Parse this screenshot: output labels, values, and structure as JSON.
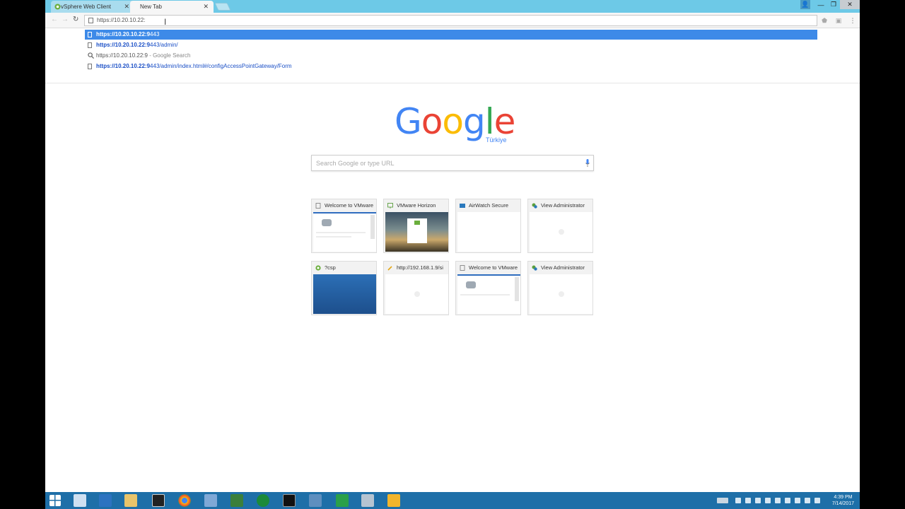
{
  "browser": {
    "tabs": [
      {
        "label": "vSphere Web Client",
        "active": false
      },
      {
        "label": "New Tab",
        "active": true
      }
    ],
    "address_value": "https://10.20.10.22:"
  },
  "suggestions": [
    {
      "url_bold": "https://10.20.10.22:9",
      "rest": "443",
      "extra": "",
      "type": "page",
      "selected": true
    },
    {
      "url_bold": "https://10.20.10.22:9",
      "rest": "443/admin/",
      "extra": "",
      "type": "page",
      "selected": false
    },
    {
      "url_bold": "",
      "rest": "https://10.20.10.22:9",
      "extra": "Google Search",
      "type": "search",
      "selected": false
    },
    {
      "url_bold": "https://10.20.10.22:9",
      "rest": "443/admin/index.html#/configAccessPointGateway/Form",
      "extra": "",
      "type": "page",
      "selected": false
    }
  ],
  "google": {
    "letters": [
      "G",
      "o",
      "o",
      "g",
      "l",
      "e"
    ],
    "colors": [
      "#4285f4",
      "#ea4335",
      "#fbbc05",
      "#4285f4",
      "#34a853",
      "#ea4335"
    ],
    "country": "Türkiye",
    "search_placeholder": "Search Google or type URL"
  },
  "tiles": [
    {
      "title": "Welcome to VMware",
      "icon": "page-icon"
    },
    {
      "title": "VMware Horizon",
      "icon": "horizon-icon"
    },
    {
      "title": "AirWatch Secure",
      "icon": "airwatch-icon"
    },
    {
      "title": "View Administrator",
      "icon": "view-icon"
    },
    {
      "title": "?csp",
      "icon": "vsphere-icon"
    },
    {
      "title": "http://192.168.1.9/si",
      "icon": "key-icon"
    },
    {
      "title": "Welcome to VMware",
      "icon": "page-icon"
    },
    {
      "title": "View Administrator",
      "icon": "view-icon"
    }
  ],
  "taskbar": {
    "time": "4:39 PM",
    "date": "7/14/2017"
  }
}
